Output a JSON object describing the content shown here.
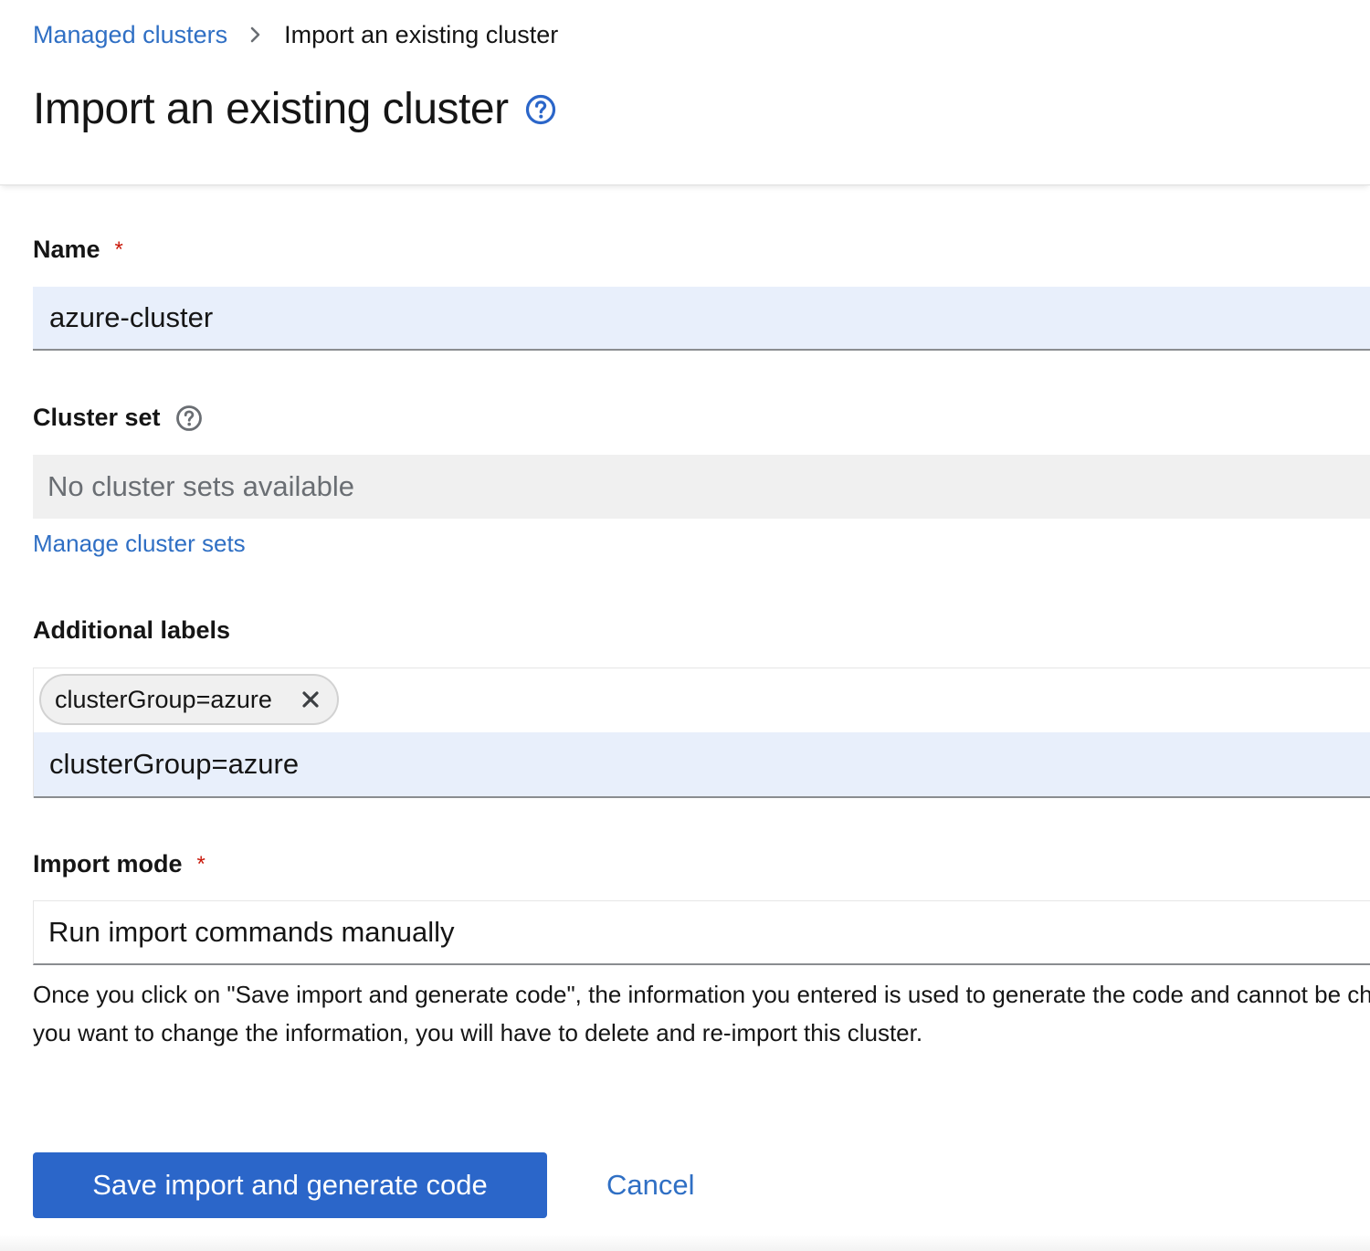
{
  "breadcrumb": {
    "parent_label": "Managed clusters",
    "current_label": "Import an existing cluster"
  },
  "page": {
    "title": "Import an existing cluster"
  },
  "form": {
    "name": {
      "label": "Name",
      "required_marker": "*",
      "value": "azure-cluster"
    },
    "cluster_set": {
      "label": "Cluster set",
      "placeholder": "No cluster sets available",
      "manage_link": "Manage cluster sets"
    },
    "additional_labels": {
      "label": "Additional labels",
      "chips": [
        "clusterGroup=azure"
      ],
      "input_value": "clusterGroup=azure"
    },
    "import_mode": {
      "label": "Import mode",
      "required_marker": "*",
      "selected": "Run import commands manually",
      "helper_text": "Once you click on \"Save import and generate code\", the information you entered is used to generate the code and cannot be changed. If you want to change the information, you will have to delete and re-import this cluster."
    }
  },
  "actions": {
    "primary_label": "Save import and generate code",
    "cancel_label": "Cancel"
  },
  "colors": {
    "link": "#2f6fc4",
    "primary": "#2b66c9",
    "required": "#c9190b",
    "input_filled_bg": "#e8effb",
    "disabled_bg": "#f0f0f0"
  }
}
